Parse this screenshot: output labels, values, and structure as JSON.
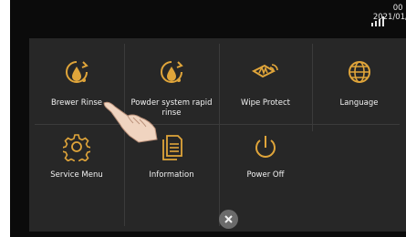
{
  "status_bar": {
    "time": "00 .",
    "date": "2021/01/"
  },
  "menu": {
    "items": [
      {
        "label": "Brewer Rinse",
        "icon": "brewer-rinse-icon"
      },
      {
        "label": "Powder system rapid rinse",
        "icon": "powder-rinse-icon"
      },
      {
        "label": "Wipe Protect",
        "icon": "wipe-protect-icon"
      },
      {
        "label": "Language",
        "icon": "globe-icon"
      },
      {
        "label": "Service Menu",
        "icon": "gear-icon"
      },
      {
        "label": "Information",
        "icon": "document-icon"
      },
      {
        "label": "Power Off",
        "icon": "power-icon"
      }
    ]
  },
  "close": {
    "icon": "close-icon"
  },
  "overlay": {
    "icon": "pointing-hand-icon"
  },
  "colors": {
    "accent": "#e0a53a",
    "panel": "#272727",
    "background": "#0b0b0b"
  }
}
